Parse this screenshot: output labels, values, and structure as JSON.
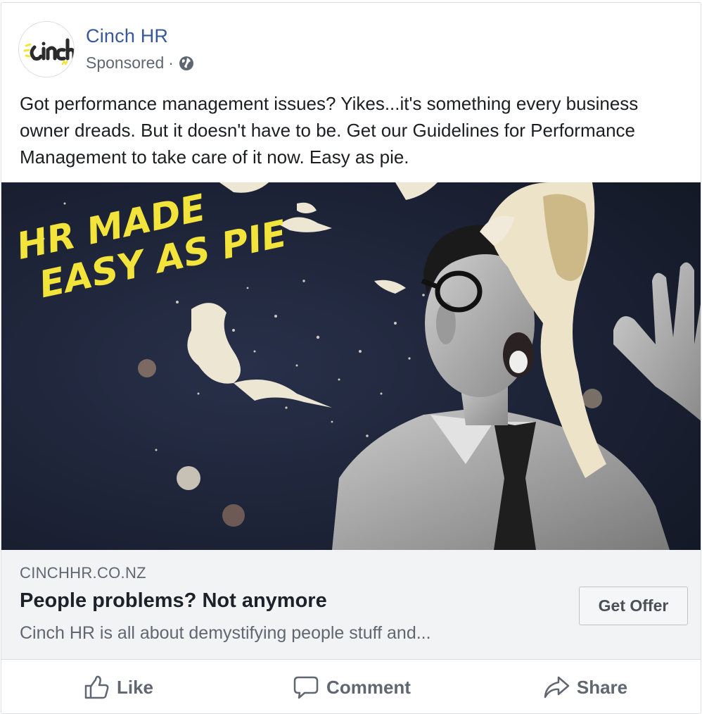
{
  "post": {
    "page_name": "Cinch HR",
    "sponsored_label": "Sponsored",
    "separator": "·",
    "privacy_icon": "globe-icon",
    "body_text": "Got performance management issues? Yikes...it's something every business owner dreads. But it doesn't have to be. Get our Guidelines for Performance Management to take care of it now. Easy as pie.",
    "avatar_logo_text": "cinch HR",
    "image": {
      "overlay_text_line1": "HR MADE",
      "overlay_text_line2": "EASY AS PIE",
      "overlay_color": "#f2e43a"
    }
  },
  "link_preview": {
    "domain": "CINCHHR.CO.NZ",
    "headline": "People problems? Not anymore",
    "description": "Cinch HR is all about demystifying people stuff and...",
    "cta_label": "Get Offer"
  },
  "actions": [
    {
      "label": "Like",
      "icon": "thumbs-up-icon"
    },
    {
      "label": "Comment",
      "icon": "comment-icon"
    },
    {
      "label": "Share",
      "icon": "share-icon"
    }
  ],
  "colors": {
    "link_blue": "#385898",
    "secondary_text": "#606770",
    "link_area_bg": "#f2f3f5",
    "brand_yellow": "#f2e43a"
  }
}
